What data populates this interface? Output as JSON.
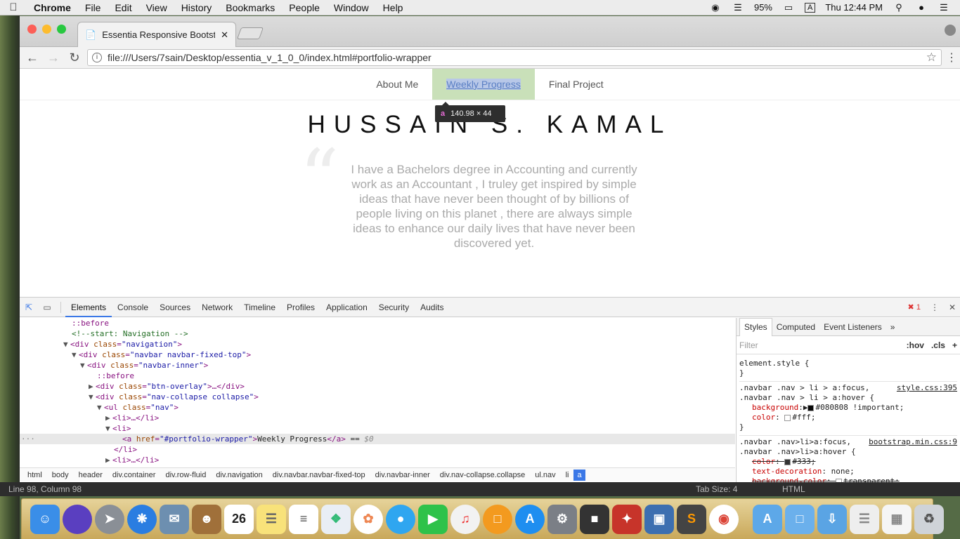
{
  "menubar": {
    "apple": "",
    "app": "Chrome",
    "items": [
      "File",
      "Edit",
      "View",
      "History",
      "Bookmarks",
      "People",
      "Window",
      "Help"
    ],
    "battery": "95%",
    "input_source": "A",
    "clock": "Thu 12:44 PM"
  },
  "browser": {
    "tab_title": "Essentia Responsive Bootstrap",
    "url": "file:///Users/7sain/Desktop/essentia_v_1_0_0/index.html#portfolio-wrapper"
  },
  "site": {
    "nav": [
      "About Me",
      "Weekly Progress",
      "Final Project"
    ],
    "heading": "HUSSAIN S. KAMAL",
    "quote_mark": "“",
    "quote": "I have a Bachelors degree in Accounting and currently work as an Accountant , I truley get inspired by simple ideas that have never been thought of by billions of people living on this planet , there are always simple ideas to enhance our daily lives that have never been discovered yet.",
    "tooltip_tag": "a",
    "tooltip_size": "140.98 × 44"
  },
  "devtools": {
    "tabs": [
      "Elements",
      "Console",
      "Sources",
      "Network",
      "Timeline",
      "Profiles",
      "Application",
      "Security",
      "Audits"
    ],
    "error_count": "1",
    "breadcrumbs": [
      "html",
      "body",
      "header",
      "div.container",
      "div.row-fluid",
      "div.navigation",
      "div.navbar.navbar-fixed-top",
      "div.navbar-inner",
      "div.nav-collapse.collapse",
      "ul.nav",
      "li",
      "a"
    ],
    "styles_tabs": [
      "Styles",
      "Computed",
      "Event Listeners"
    ],
    "filter_placeholder": "Filter",
    "hov": ":hov",
    "cls": ".cls"
  },
  "statusbar": {
    "position": "Line 98, Column 98",
    "tab_size": "Tab Size: 4",
    "syntax": "HTML"
  }
}
